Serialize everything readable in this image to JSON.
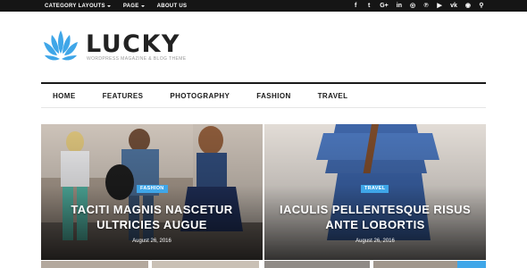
{
  "topbar": {
    "nav": [
      {
        "label": "CATEGORY LAYOUTS",
        "dropdown": true
      },
      {
        "label": "PAGE",
        "dropdown": true
      },
      {
        "label": "ABOUT US",
        "dropdown": false
      }
    ],
    "social": [
      {
        "icon": "facebook-icon",
        "glyph": "f"
      },
      {
        "icon": "twitter-icon",
        "glyph": "t"
      },
      {
        "icon": "google-plus-icon",
        "glyph": "G+"
      },
      {
        "icon": "linkedin-icon",
        "glyph": "in"
      },
      {
        "icon": "instagram-icon",
        "glyph": "◎"
      },
      {
        "icon": "pinterest-icon",
        "glyph": "℗"
      },
      {
        "icon": "youtube-icon",
        "glyph": "▶"
      },
      {
        "icon": "vk-icon",
        "glyph": "vk"
      },
      {
        "icon": "rss-icon",
        "glyph": "◉"
      },
      {
        "icon": "search-icon",
        "glyph": "⚲"
      }
    ]
  },
  "logo": {
    "title": "LUCKY",
    "subtitle": "WORDPRESS MAGAZINE & BLOG THEME",
    "accent": "#3fa6e8"
  },
  "main_nav": [
    "HOME",
    "FEATURES",
    "PHOTOGRAPHY",
    "FASHION",
    "TRAVEL"
  ],
  "featured": [
    {
      "category": "FASHION",
      "title": "TACITI MAGNIS NASCETUR ULTRICIES AUGUE",
      "date": "August 26, 2016"
    },
    {
      "category": "TRAVEL",
      "title": "IACULIS PELLENTESQUE RISUS ANTE LOBORTIS",
      "date": "August 26, 2016"
    }
  ],
  "colors": {
    "topbar": "#151515",
    "accent": "#3fa6e8",
    "text": "#1a1a1a"
  }
}
